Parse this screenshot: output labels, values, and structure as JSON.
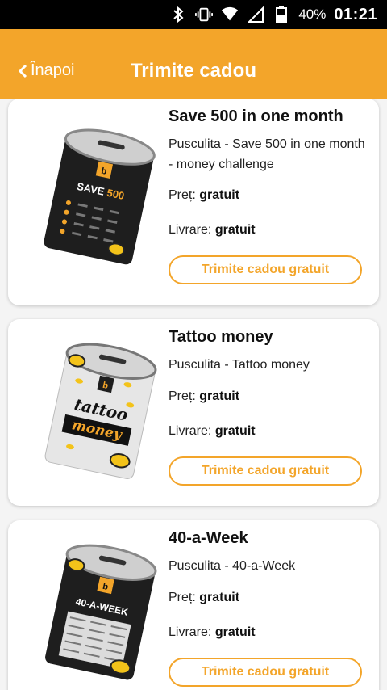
{
  "status_bar": {
    "icons": [
      "bluetooth-icon",
      "vibrate-icon",
      "wifi-icon",
      "signal-icon",
      "battery-icon"
    ],
    "battery": "40%",
    "time": "01:21"
  },
  "header": {
    "back_label": "Înapoi",
    "title": "Trimite cadou",
    "color": "#f3a52a"
  },
  "products": [
    {
      "name": "Save 500 in one month",
      "description": "Pusculita - Save 500 in one month - money challenge",
      "price_label": "Preț:",
      "price_value": "gratuit",
      "delivery_label": "Livrare:",
      "delivery_value": "gratuit",
      "button": "Trimite cadou gratuit",
      "can_label": "SAVE 500",
      "can_theme": "dark"
    },
    {
      "name": "Tattoo money",
      "description": "Pusculita - Tattoo money",
      "price_label": "Preț:",
      "price_value": "gratuit",
      "delivery_label": "Livrare:",
      "delivery_value": "gratuit",
      "button": "Trimite cadou gratuit",
      "can_label": "tattoo money",
      "can_theme": "light"
    },
    {
      "name": "40-a-Week",
      "description": "Pusculita - 40-a-Week",
      "price_label": "Preț:",
      "price_value": "gratuit",
      "delivery_label": "Livrare:",
      "delivery_value": "gratuit",
      "button": "Trimite cadou gratuit",
      "can_label": "40-A-WEEK",
      "can_theme": "dark"
    }
  ]
}
